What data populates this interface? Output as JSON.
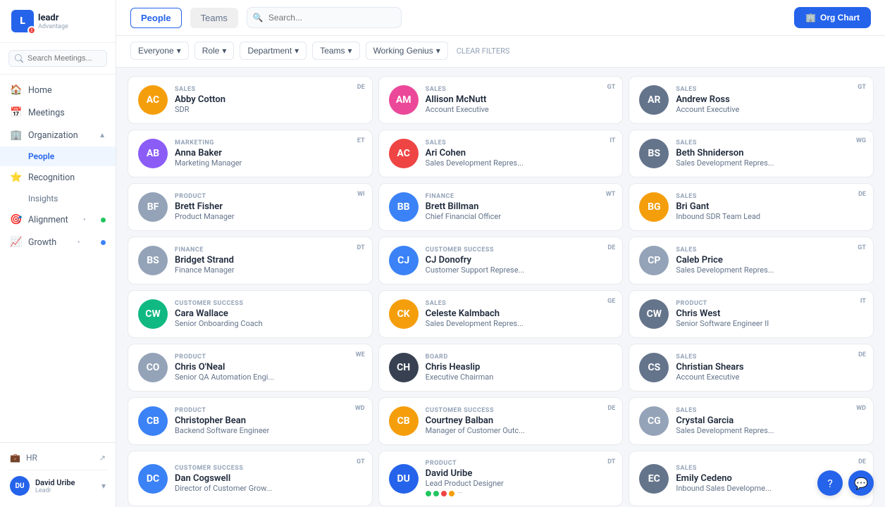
{
  "logo": {
    "text": "leadr",
    "sub": "Advantage"
  },
  "sidebar": {
    "search_placeholder": "Search Meetings...",
    "nav_items": [
      {
        "id": "home",
        "label": "Home",
        "icon": "🏠"
      },
      {
        "id": "meetings",
        "label": "Meetings",
        "icon": "📅"
      },
      {
        "id": "organization",
        "label": "Organization",
        "icon": "🏢",
        "expandable": true
      },
      {
        "id": "people",
        "label": "People",
        "icon": "👤",
        "active": true,
        "sub": true
      },
      {
        "id": "recognition",
        "label": "Recognition",
        "icon": "⭐"
      },
      {
        "id": "insights",
        "label": "Insights",
        "icon": "📊",
        "sub": true
      },
      {
        "id": "alignment",
        "label": "Alignment",
        "icon": "🎯",
        "expandable": true,
        "dot": "green"
      },
      {
        "id": "growth",
        "label": "Growth",
        "icon": "📈",
        "expandable": true,
        "dot": "blue"
      }
    ],
    "hr_label": "HR",
    "user": {
      "name": "David Uribe",
      "role": "Leadr",
      "initials": "DU"
    }
  },
  "topbar": {
    "tabs": [
      {
        "id": "people",
        "label": "People",
        "active": true
      },
      {
        "id": "teams",
        "label": "Teams",
        "active": false
      }
    ],
    "search_placeholder": "Search...",
    "org_chart_btn": "Org Chart"
  },
  "filters": {
    "everyone": "Everyone",
    "role": "Role",
    "department": "Department",
    "teams": "Teams",
    "working_genius": "Working Genius",
    "clear": "CLEAR FILTERS"
  },
  "people": [
    {
      "id": 1,
      "name": "Abby Cotton",
      "role": "SDR",
      "dept": "SALES",
      "badge": "DE",
      "color": "#f59e0b",
      "initials": "AC",
      "has_photo": true,
      "photo_color": "#d97706"
    },
    {
      "id": 2,
      "name": "Allison McNutt",
      "role": "Account Executive",
      "dept": "SALES",
      "badge": "GT",
      "color": "#ec4899",
      "initials": "AM",
      "has_photo": true,
      "photo_color": "#db2777"
    },
    {
      "id": 3,
      "name": "Andrew Ross",
      "role": "Account Executive",
      "dept": "SALES",
      "badge": "GT",
      "color": "#64748b",
      "initials": "AR",
      "has_photo": true,
      "photo_color": "#475569"
    },
    {
      "id": 4,
      "name": "Anna Baker",
      "role": "Marketing Manager",
      "dept": "MARKETING",
      "badge": "ET",
      "color": "#8b5cf6",
      "initials": "AB",
      "has_photo": true,
      "photo_color": "#7c3aed"
    },
    {
      "id": 5,
      "name": "Ari Cohen",
      "role": "Sales Development Repres...",
      "dept": "SALES",
      "badge": "IT",
      "color": "#ef4444",
      "initials": "AC2",
      "has_photo": true,
      "photo_color": "#dc2626"
    },
    {
      "id": 6,
      "name": "Beth Shniderson",
      "role": "Sales Development Repres...",
      "dept": "SALES",
      "badge": "WG",
      "color": "#64748b",
      "initials": "BS",
      "has_photo": true,
      "photo_color": "#475569"
    },
    {
      "id": 7,
      "name": "Brett Fisher",
      "role": "Product Manager",
      "dept": "PRODUCT",
      "badge": "WI",
      "color": "#94a3b8",
      "initials": "BF",
      "has_photo": true,
      "photo_color": "#64748b"
    },
    {
      "id": 8,
      "name": "Brett Billman",
      "role": "Chief Financial Officer",
      "dept": "FINANCE",
      "badge": "WT",
      "color": "#3b82f6",
      "initials": "BB",
      "has_photo": true,
      "photo_color": "#2563eb"
    },
    {
      "id": 9,
      "name": "Bri Gant",
      "role": "Inbound SDR Team Lead",
      "dept": "SALES",
      "badge": "DE",
      "color": "#f59e0b",
      "initials": "BG",
      "has_photo": true,
      "photo_color": "#d97706"
    },
    {
      "id": 10,
      "name": "Bridget Strand",
      "role": "Finance Manager",
      "dept": "FINANCE",
      "badge": "DT",
      "color": "#94a3b8",
      "initials": "BS2",
      "has_photo": true,
      "photo_color": "#64748b"
    },
    {
      "id": 11,
      "name": "CJ Donofry",
      "role": "Customer Support Represe...",
      "dept": "CUSTOMER SUCCESS",
      "badge": "DE",
      "color": "#3b82f6",
      "initials": "CJ",
      "has_photo": true,
      "photo_color": "#2563eb"
    },
    {
      "id": 12,
      "name": "Caleb Price",
      "role": "Sales Development Repres...",
      "dept": "SALES",
      "badge": "GT",
      "color": "#94a3b8",
      "initials": "CP",
      "has_photo": true,
      "photo_color": "#64748b"
    },
    {
      "id": 13,
      "name": "Cara Wallace",
      "role": "Senior Onboarding Coach",
      "dept": "CUSTOMER SUCCESS",
      "badge": "",
      "initials": "CW",
      "color": "#10b981",
      "bg_initials": true
    },
    {
      "id": 14,
      "name": "Celeste Kalmbach",
      "role": "Sales Development Repres...",
      "dept": "SALES",
      "badge": "GE",
      "color": "#f59e0b",
      "initials": "CK",
      "has_photo": true,
      "photo_color": "#d97706"
    },
    {
      "id": 15,
      "name": "Chris West",
      "role": "Senior Software Engineer II",
      "dept": "PRODUCT",
      "badge": "IT",
      "color": "#64748b",
      "initials": "CW2",
      "has_photo": true,
      "photo_color": "#475569"
    },
    {
      "id": 16,
      "name": "Chris O'Neal",
      "role": "Senior QA Automation Engi...",
      "dept": "PRODUCT",
      "badge": "WE",
      "color": "#94a3b8",
      "initials": "CO",
      "has_photo": true,
      "photo_color": "#64748b"
    },
    {
      "id": 17,
      "name": "Chris Heaslip",
      "role": "Executive Chairman",
      "dept": "BOARD",
      "badge": "",
      "color": "#374151",
      "initials": "CH",
      "has_photo": true,
      "photo_color": "#374151"
    },
    {
      "id": 18,
      "name": "Christian Shears",
      "role": "Account Executive",
      "dept": "SALES",
      "badge": "DE",
      "color": "#64748b",
      "initials": "CS",
      "has_photo": true,
      "photo_color": "#475569"
    },
    {
      "id": 19,
      "name": "Christopher Bean",
      "role": "Backend Software Engineer",
      "dept": "PRODUCT",
      "badge": "WD",
      "color": "#3b82f6",
      "initials": "CB",
      "has_photo": true,
      "photo_color": "#2563eb"
    },
    {
      "id": 20,
      "name": "Courtney Balban",
      "role": "Manager of Customer Outc...",
      "dept": "CUSTOMER SUCCESS",
      "badge": "DE",
      "color": "#f59e0b",
      "initials": "CB2",
      "has_photo": true,
      "photo_color": "#d97706"
    },
    {
      "id": 21,
      "name": "Crystal Garcia",
      "role": "Sales Development Repres...",
      "dept": "SALES",
      "badge": "WD",
      "color": "#94a3b8",
      "initials": "CG",
      "has_photo": true,
      "photo_color": "#64748b"
    },
    {
      "id": 22,
      "name": "Dan Cogswell",
      "role": "Director of Customer Grow...",
      "dept": "CUSTOMER SUCCESS",
      "badge": "GT",
      "color": "#3b82f6",
      "initials": "DC",
      "has_photo": true,
      "photo_color": "#2563eb"
    },
    {
      "id": 23,
      "name": "David Uribe",
      "role": "Lead Product Designer",
      "dept": "PRODUCT",
      "badge": "DT",
      "color": "#2563eb",
      "initials": "DU",
      "has_photo": true,
      "photo_color": "#1d4ed8",
      "has_status": true,
      "status_dots": [
        "#22c55e",
        "#22c55e",
        "#ef4444",
        "#f59e0b"
      ]
    },
    {
      "id": 24,
      "name": "Emily Cedeno",
      "role": "Inbound Sales Developme...",
      "dept": "SALES",
      "badge": "DE",
      "color": "#64748b",
      "initials": "EC",
      "has_photo": true,
      "photo_color": "#475569"
    }
  ]
}
